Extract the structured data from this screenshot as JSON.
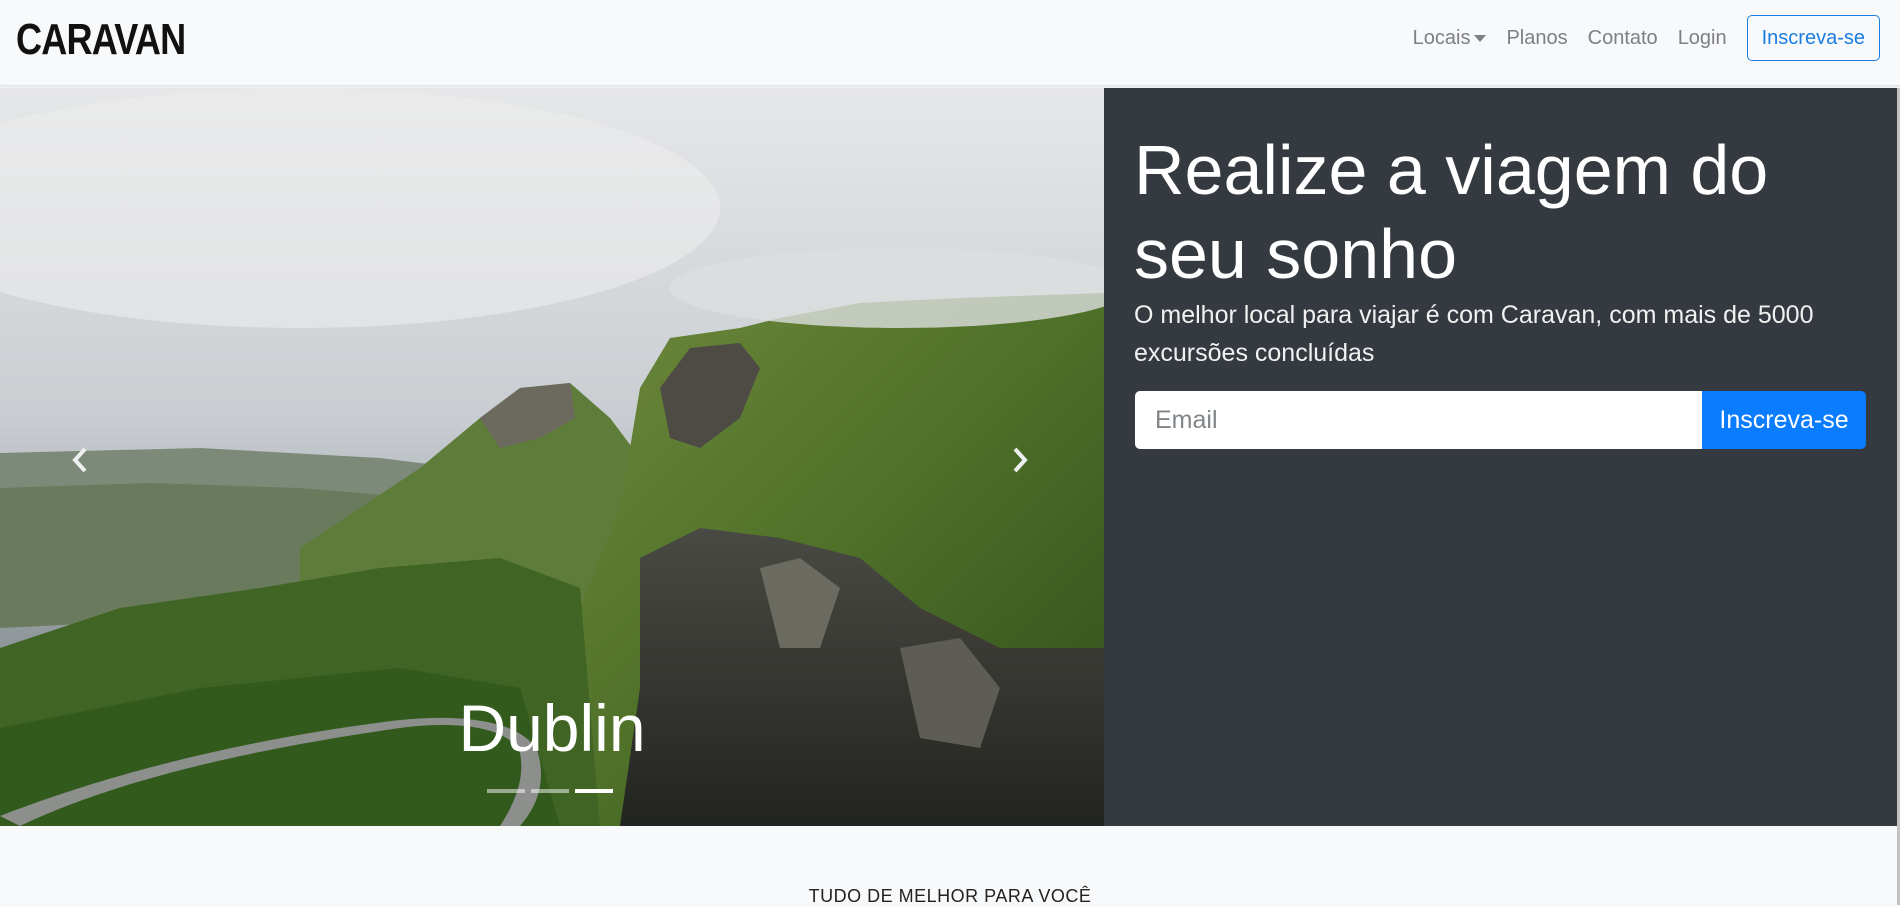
{
  "navbar": {
    "brand": "CARAVAN",
    "links": [
      "Locais",
      "Planos",
      "Contato",
      "Login"
    ],
    "signup_button": "Inscreva-se"
  },
  "carousel": {
    "caption": "Dublin",
    "slide_count": 3,
    "active_index": 2,
    "prev_icon": "chevron-left-icon",
    "next_icon": "chevron-right-icon"
  },
  "hero": {
    "headline": "Realize a viagem do seu sonho",
    "lead": "O melhor local para viajar é com Caravan, com mais de 5000 excursões concluídas",
    "email_placeholder": "Email",
    "submit_label": "Inscreva-se"
  },
  "section": {
    "title": "TUDO DE MELHOR PARA VOCÊ"
  },
  "colors": {
    "accent": "#0a7cff",
    "panel": "#343a40",
    "navbar": "#f8f9fa"
  }
}
